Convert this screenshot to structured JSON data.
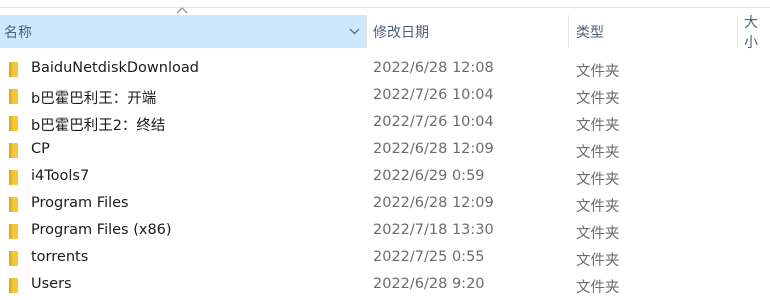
{
  "columns": {
    "name": "名称",
    "date": "修改日期",
    "type": "类型",
    "size": "大小"
  },
  "icons": {
    "sort": "sort-up-chevron-icon",
    "dropdown": "chevron-down-icon",
    "folder": "folder-icon"
  },
  "colors": {
    "header_selected_bg": "#cce8ff",
    "folder_yellow": "#f8c43a",
    "folder_dark": "#e0a922"
  },
  "files": [
    {
      "name": "BaiduNetdiskDownload",
      "date": "2022/6/28 12:08",
      "type": "文件夹"
    },
    {
      "name": "b巴霍巴利王：开端",
      "date": "2022/7/26 10:04",
      "type": "文件夹"
    },
    {
      "name": "b巴霍巴利王2：终结",
      "date": "2022/7/26 10:04",
      "type": "文件夹"
    },
    {
      "name": "CP",
      "date": "2022/6/28 12:09",
      "type": "文件夹"
    },
    {
      "name": "i4Tools7",
      "date": "2022/6/29 0:59",
      "type": "文件夹"
    },
    {
      "name": "Program Files",
      "date": "2022/6/28 12:09",
      "type": "文件夹"
    },
    {
      "name": "Program Files (x86)",
      "date": "2022/7/18 13:30",
      "type": "文件夹"
    },
    {
      "name": "torrents",
      "date": "2022/7/25 0:55",
      "type": "文件夹"
    },
    {
      "name": "Users",
      "date": "2022/6/28 9:20",
      "type": "文件夹"
    }
  ]
}
